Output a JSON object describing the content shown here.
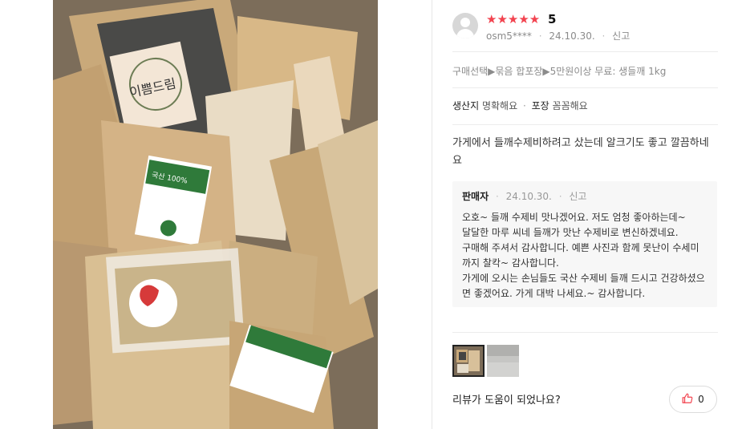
{
  "review": {
    "stars": "★★★★★",
    "score": "5",
    "user": "osm5****",
    "date": "24.10.30.",
    "report": "신고",
    "option": "구매선택▶묶음 합포장▶5만원이상 무료: 생들깨 1kg",
    "evaluations": [
      {
        "key": "생산지",
        "value": "명확해요"
      },
      {
        "key": "포장",
        "value": "꼼꼼해요"
      }
    ],
    "content": "가게에서 들깨수제비하려고 샀는데 알크기도 좋고 깔끔하네요"
  },
  "seller_reply": {
    "name": "판매자",
    "date": "24.10.30.",
    "report": "신고",
    "lines": [
      "오호~ 들깨 수제비  맛나겠어요. 저도 엄청 좋아하는데~",
      "달달한 마루 씨네 들깨가 맛난 수제비로 변신하겠네요.",
      "구매해 주셔서 감사합니다. 예쁜 사진과 함께 못난이 수세미",
      "까지 찰칵~ 감사합니다.",
      "가게에 오시는 손님들도 국산 수제비 들깨 드시고 건강하셨으",
      "면 좋겠어요. 가게 대박 나세요.~ 감사합니다."
    ]
  },
  "photo_labels": {
    "bag_brand": "이쁨드림",
    "green_label": "국산 100%"
  },
  "footer": {
    "helpful_question": "리뷰가 도움이 되었나요?",
    "like_count": "0"
  },
  "colors": {
    "star": "#f2434f",
    "text_muted": "#8b8b8b",
    "reply_bg": "#f7f7f7"
  },
  "icons": {
    "like": "thumbs-up-icon",
    "avatar": "default-avatar-icon"
  }
}
